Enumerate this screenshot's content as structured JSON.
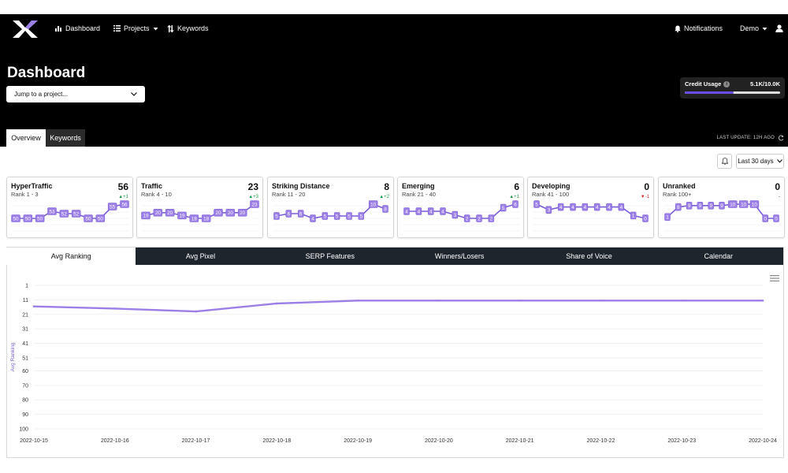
{
  "nav": {
    "items": [
      {
        "label": "Dashboard",
        "icon": "bar-chart-icon"
      },
      {
        "label": "Projects",
        "icon": "list-icon"
      },
      {
        "label": "Keywords",
        "icon": "sort-icon"
      }
    ],
    "notifications_label": "Notifications",
    "user_label": "Demo"
  },
  "page": {
    "title": "Dashboard",
    "jump_placeholder": "Jump to a project..."
  },
  "credit": {
    "label": "Credit Usage",
    "value": "5.1K/10.0K",
    "fraction": 0.51,
    "info_glyph": "i"
  },
  "tabs": {
    "overview": "Overview",
    "keywords": "Keywords"
  },
  "last_update": "LAST UPDATE: 12H AGO",
  "range_selector": "Last 30 days",
  "cards": [
    {
      "name": "HyperTraffic",
      "range": "Rank 1 - 3",
      "value": "56",
      "delta": "▲+1",
      "delta_dir": "up",
      "points": [
        50,
        50,
        50,
        53,
        52,
        52,
        50,
        50,
        55,
        56
      ]
    },
    {
      "name": "Traffic",
      "range": "Rank 4 - 10",
      "value": "23",
      "delta": "▲+3",
      "delta_dir": "up",
      "points": [
        19,
        20,
        20,
        19,
        18,
        18,
        20,
        20,
        20,
        23
      ]
    },
    {
      "name": "Striking Distance",
      "range": "Rank 11 - 20",
      "value": "8",
      "delta": "▲+2",
      "delta_dir": "up",
      "points": [
        5,
        6,
        6,
        4,
        5,
        5,
        5,
        5,
        10,
        8
      ]
    },
    {
      "name": "Emerging",
      "range": "Rank 21 - 40",
      "value": "6",
      "delta": "▲+1",
      "delta_dir": "up",
      "points": [
        4,
        4,
        4,
        4,
        3,
        2,
        2,
        2,
        5,
        6
      ]
    },
    {
      "name": "Developing",
      "range": "Rank 41 - 100",
      "value": "0",
      "delta": "▼-1",
      "delta_dir": "down",
      "points": [
        5,
        3,
        4,
        4,
        4,
        4,
        4,
        4,
        1,
        0
      ]
    },
    {
      "name": "Unranked",
      "range": "Rank 100+",
      "value": "0",
      "delta": "-",
      "delta_dir": "none",
      "points": [
        1,
        8,
        9,
        9,
        9,
        9,
        10,
        10,
        10,
        0,
        0
      ]
    }
  ],
  "chart_tabs": [
    "Avg Ranking",
    "Avg Pixel",
    "SERP Features",
    "Winners/Losers",
    "Share of Voice",
    "Calendar"
  ],
  "colors": {
    "accent": "#9b7fe6",
    "accent_dark": "#7a5cd6",
    "up": "#1e9e4a",
    "down": "#d9302c"
  },
  "chart_data": {
    "type": "line",
    "ylabel": "Avg Ranking",
    "xlabel": "",
    "y_inverted": true,
    "ylim": [
      1,
      100
    ],
    "y_ticks": [
      1,
      11,
      21,
      31,
      41,
      51,
      60,
      70,
      80,
      90,
      100
    ],
    "categories": [
      "2022-10-15",
      "2022-10-16",
      "2022-10-17",
      "2022-10-18",
      "2022-10-19",
      "2022-10-20",
      "2022-10-21",
      "2022-10-22",
      "2022-10-23",
      "2022-10-24"
    ],
    "values": [
      15.5,
      17,
      19,
      13.5,
      11.5,
      11.5,
      11.5,
      11.5,
      11.5,
      11.5
    ],
    "grid": true
  }
}
